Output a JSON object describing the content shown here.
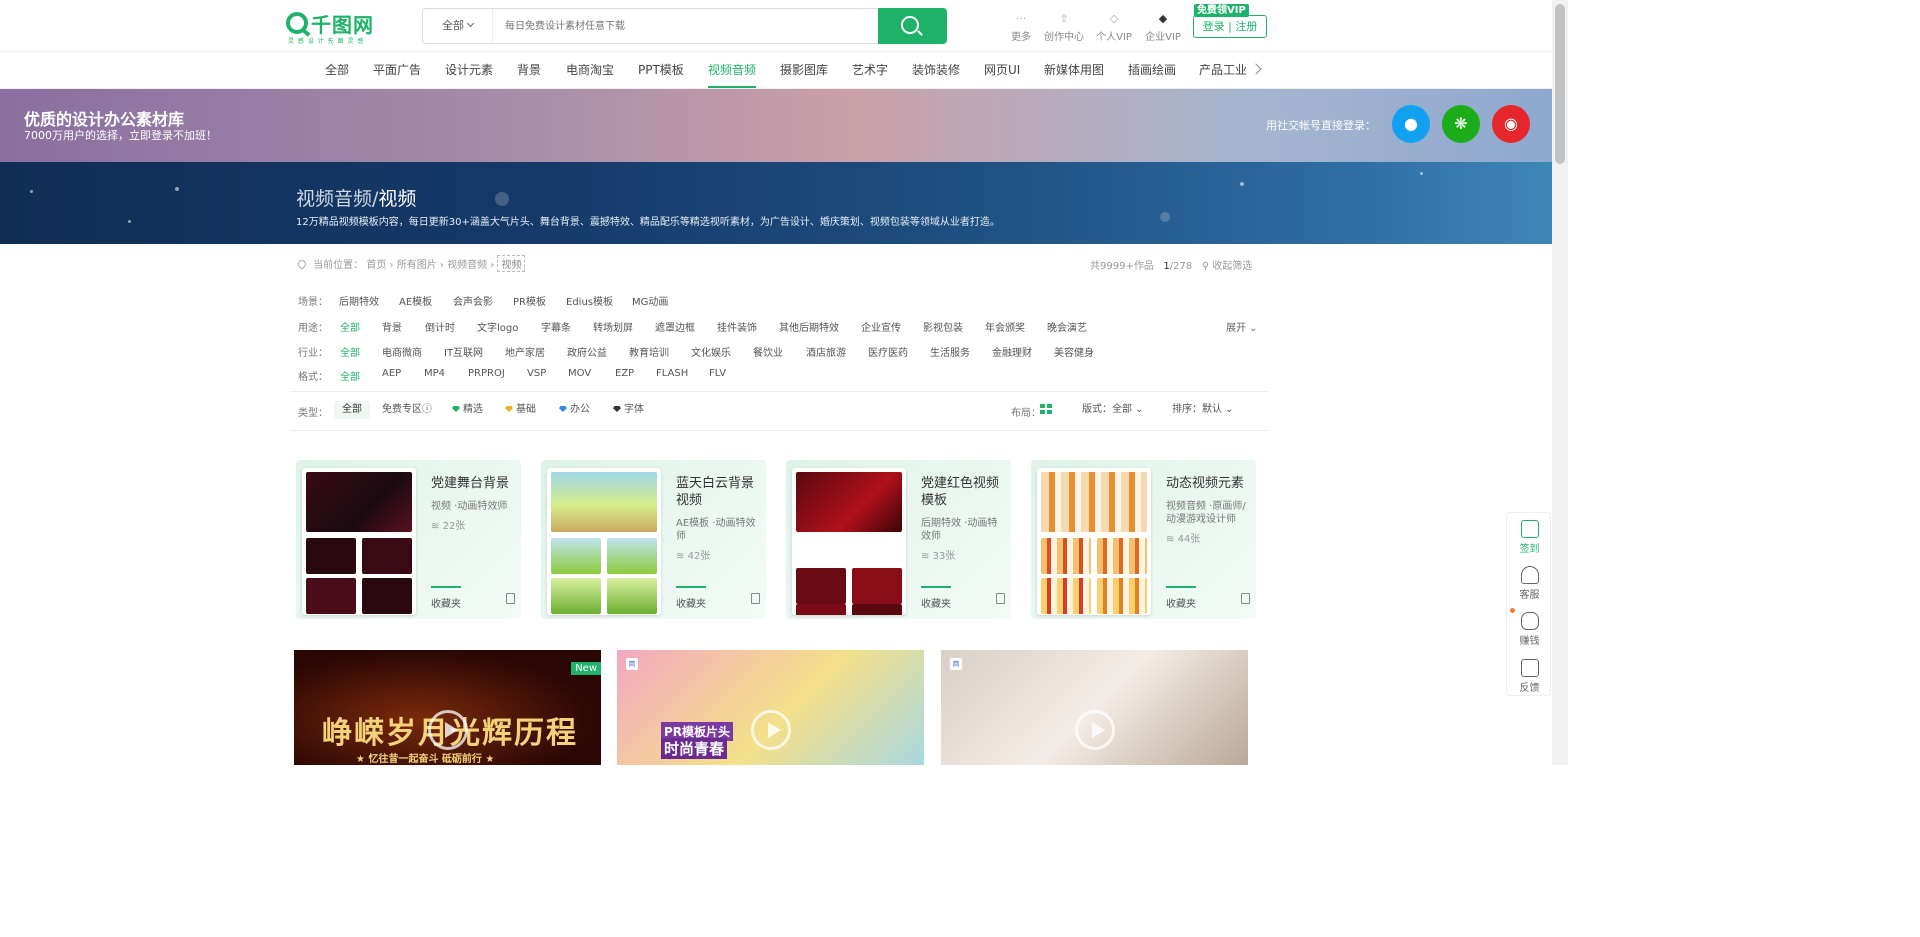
{
  "header": {
    "logo_name": "千图网",
    "logo_slogan": "灵 感 设 计   先 图 灵 感",
    "search": {
      "category": "全部",
      "placeholder": "每日免费设计素材任意下载"
    },
    "tools": [
      {
        "icon": "more-icon",
        "glyph": "···",
        "label": "更多"
      },
      {
        "icon": "upload-icon",
        "glyph": "⇧",
        "label": "创作中心"
      },
      {
        "icon": "diamond-icon",
        "glyph": "◇",
        "label": "个人VIP"
      },
      {
        "icon": "enterprise-diamond-icon",
        "glyph": "◆",
        "label": "企业VIP"
      }
    ],
    "vip_badge": "免费领VIP",
    "login_label": "登录 | 注册"
  },
  "nav": {
    "items": [
      "全部",
      "平面广告",
      "设计元素",
      "背景",
      "电商淘宝",
      "PPT模板",
      "视频音频",
      "摄影图库",
      "艺术字",
      "装饰装修",
      "网页UI",
      "新媒体用图",
      "插画绘画",
      "产品工业"
    ],
    "active": "视频音频"
  },
  "promo": {
    "title": "优质的设计办公素材库",
    "subtitle": "7000万用户的选择，立即登录不加班！",
    "social_label": "用社交帐号直接登录：",
    "social": [
      {
        "icon": "qq-icon",
        "color": "#12a0f0"
      },
      {
        "icon": "wechat-icon",
        "color": "#1aad19"
      },
      {
        "icon": "weibo-icon",
        "color": "#e6262a"
      }
    ]
  },
  "banner": {
    "title_prefix": "视频音频/",
    "title_main": "视频",
    "desc": "12万精品视频模板内容，每日更新30+涵盖大气片头、舞台背景、震撼特效、精品配乐等精选视听素材，为广告设计、婚庆策划、视频包装等领域从业者打造。"
  },
  "breadcrumb": {
    "label": "当前位置：",
    "path": "首页 › 所有图片 › 视频音频 ›",
    "current": "视频"
  },
  "count": {
    "total": "共9999+作品",
    "page": "1",
    "pages": "/278",
    "collapse_label": "收起筛选"
  },
  "filters": {
    "scene": {
      "label": "场景：",
      "options": [
        "后期特效",
        "AE模板",
        "会声会影",
        "PR模板",
        "Edius模板",
        "MG动画"
      ]
    },
    "usage": {
      "label": "用途：",
      "options": [
        "全部",
        "背景",
        "倒计时",
        "文字logo",
        "字幕条",
        "转场划屏",
        "遮罩边框",
        "挂件装饰",
        "其他后期特效",
        "企业宣传",
        "影视包装",
        "年会颁奖",
        "晚会演艺"
      ]
    },
    "industry": {
      "label": "行业：",
      "options": [
        "全部",
        "电商微商",
        "IT互联网",
        "地产家居",
        "政府公益",
        "教育培训",
        "文化娱乐",
        "餐饮业",
        "酒店旅游",
        "医疗医药",
        "生活服务",
        "金融理财",
        "美容健身"
      ]
    },
    "format": {
      "label": "格式：",
      "options": [
        "全部",
        "AEP",
        "MP4",
        "PRPROJ",
        "VSP",
        "MOV",
        "EZP",
        "FLASH",
        "FLV"
      ]
    },
    "expand_label": "展开"
  },
  "typebar": {
    "label": "类型：",
    "types": [
      {
        "label": "全部",
        "gem": ""
      },
      {
        "label": "免费专区ⓘ",
        "gem": ""
      },
      {
        "label": "精选",
        "gem": "#1fb36a"
      },
      {
        "label": "基础",
        "gem": "#f0b020"
      },
      {
        "label": "办公",
        "gem": "#2a8ee8"
      },
      {
        "label": "字体",
        "gem": "#333333"
      }
    ],
    "layout_label": "布局：",
    "format_label": "版式：全部",
    "sort_label": "排序：默认"
  },
  "collections": [
    {
      "title": "党建舞台背景",
      "meta": "视频 ·动画特效师",
      "count": "22张",
      "fav": "收藏夹"
    },
    {
      "title": "蓝天白云背景视频",
      "meta": "AE模板 ·动画特效师",
      "count": "42张",
      "fav": "收藏夹"
    },
    {
      "title": "党建红色视频模板",
      "meta": "后期特效 ·动画特效师",
      "count": "33张",
      "fav": "收藏夹"
    },
    {
      "title": "动态视频元素",
      "meta": "视频音频 ·原画师/动漫游戏设计师",
      "count": "44张",
      "fav": "收藏夹"
    }
  ],
  "videos": [
    {
      "tag": "",
      "badge": "New",
      "text": "峥嵘岁月光辉历程",
      "subtext": "★ 忆往昔一起奋斗 砥砺前行 ★"
    },
    {
      "tag": "商",
      "badge": "",
      "text": "PR模板片头",
      "subtext": "时尚青春"
    },
    {
      "tag": "商",
      "badge": "",
      "text": "",
      "subtext": ""
    }
  ],
  "sidebar": {
    "items": [
      {
        "icon": "checkin-icon",
        "label": "签到"
      },
      {
        "icon": "headset-icon",
        "label": "客服"
      },
      {
        "icon": "money-bag-icon",
        "label": "赚钱"
      },
      {
        "icon": "feedback-icon",
        "label": "反馈"
      }
    ]
  }
}
